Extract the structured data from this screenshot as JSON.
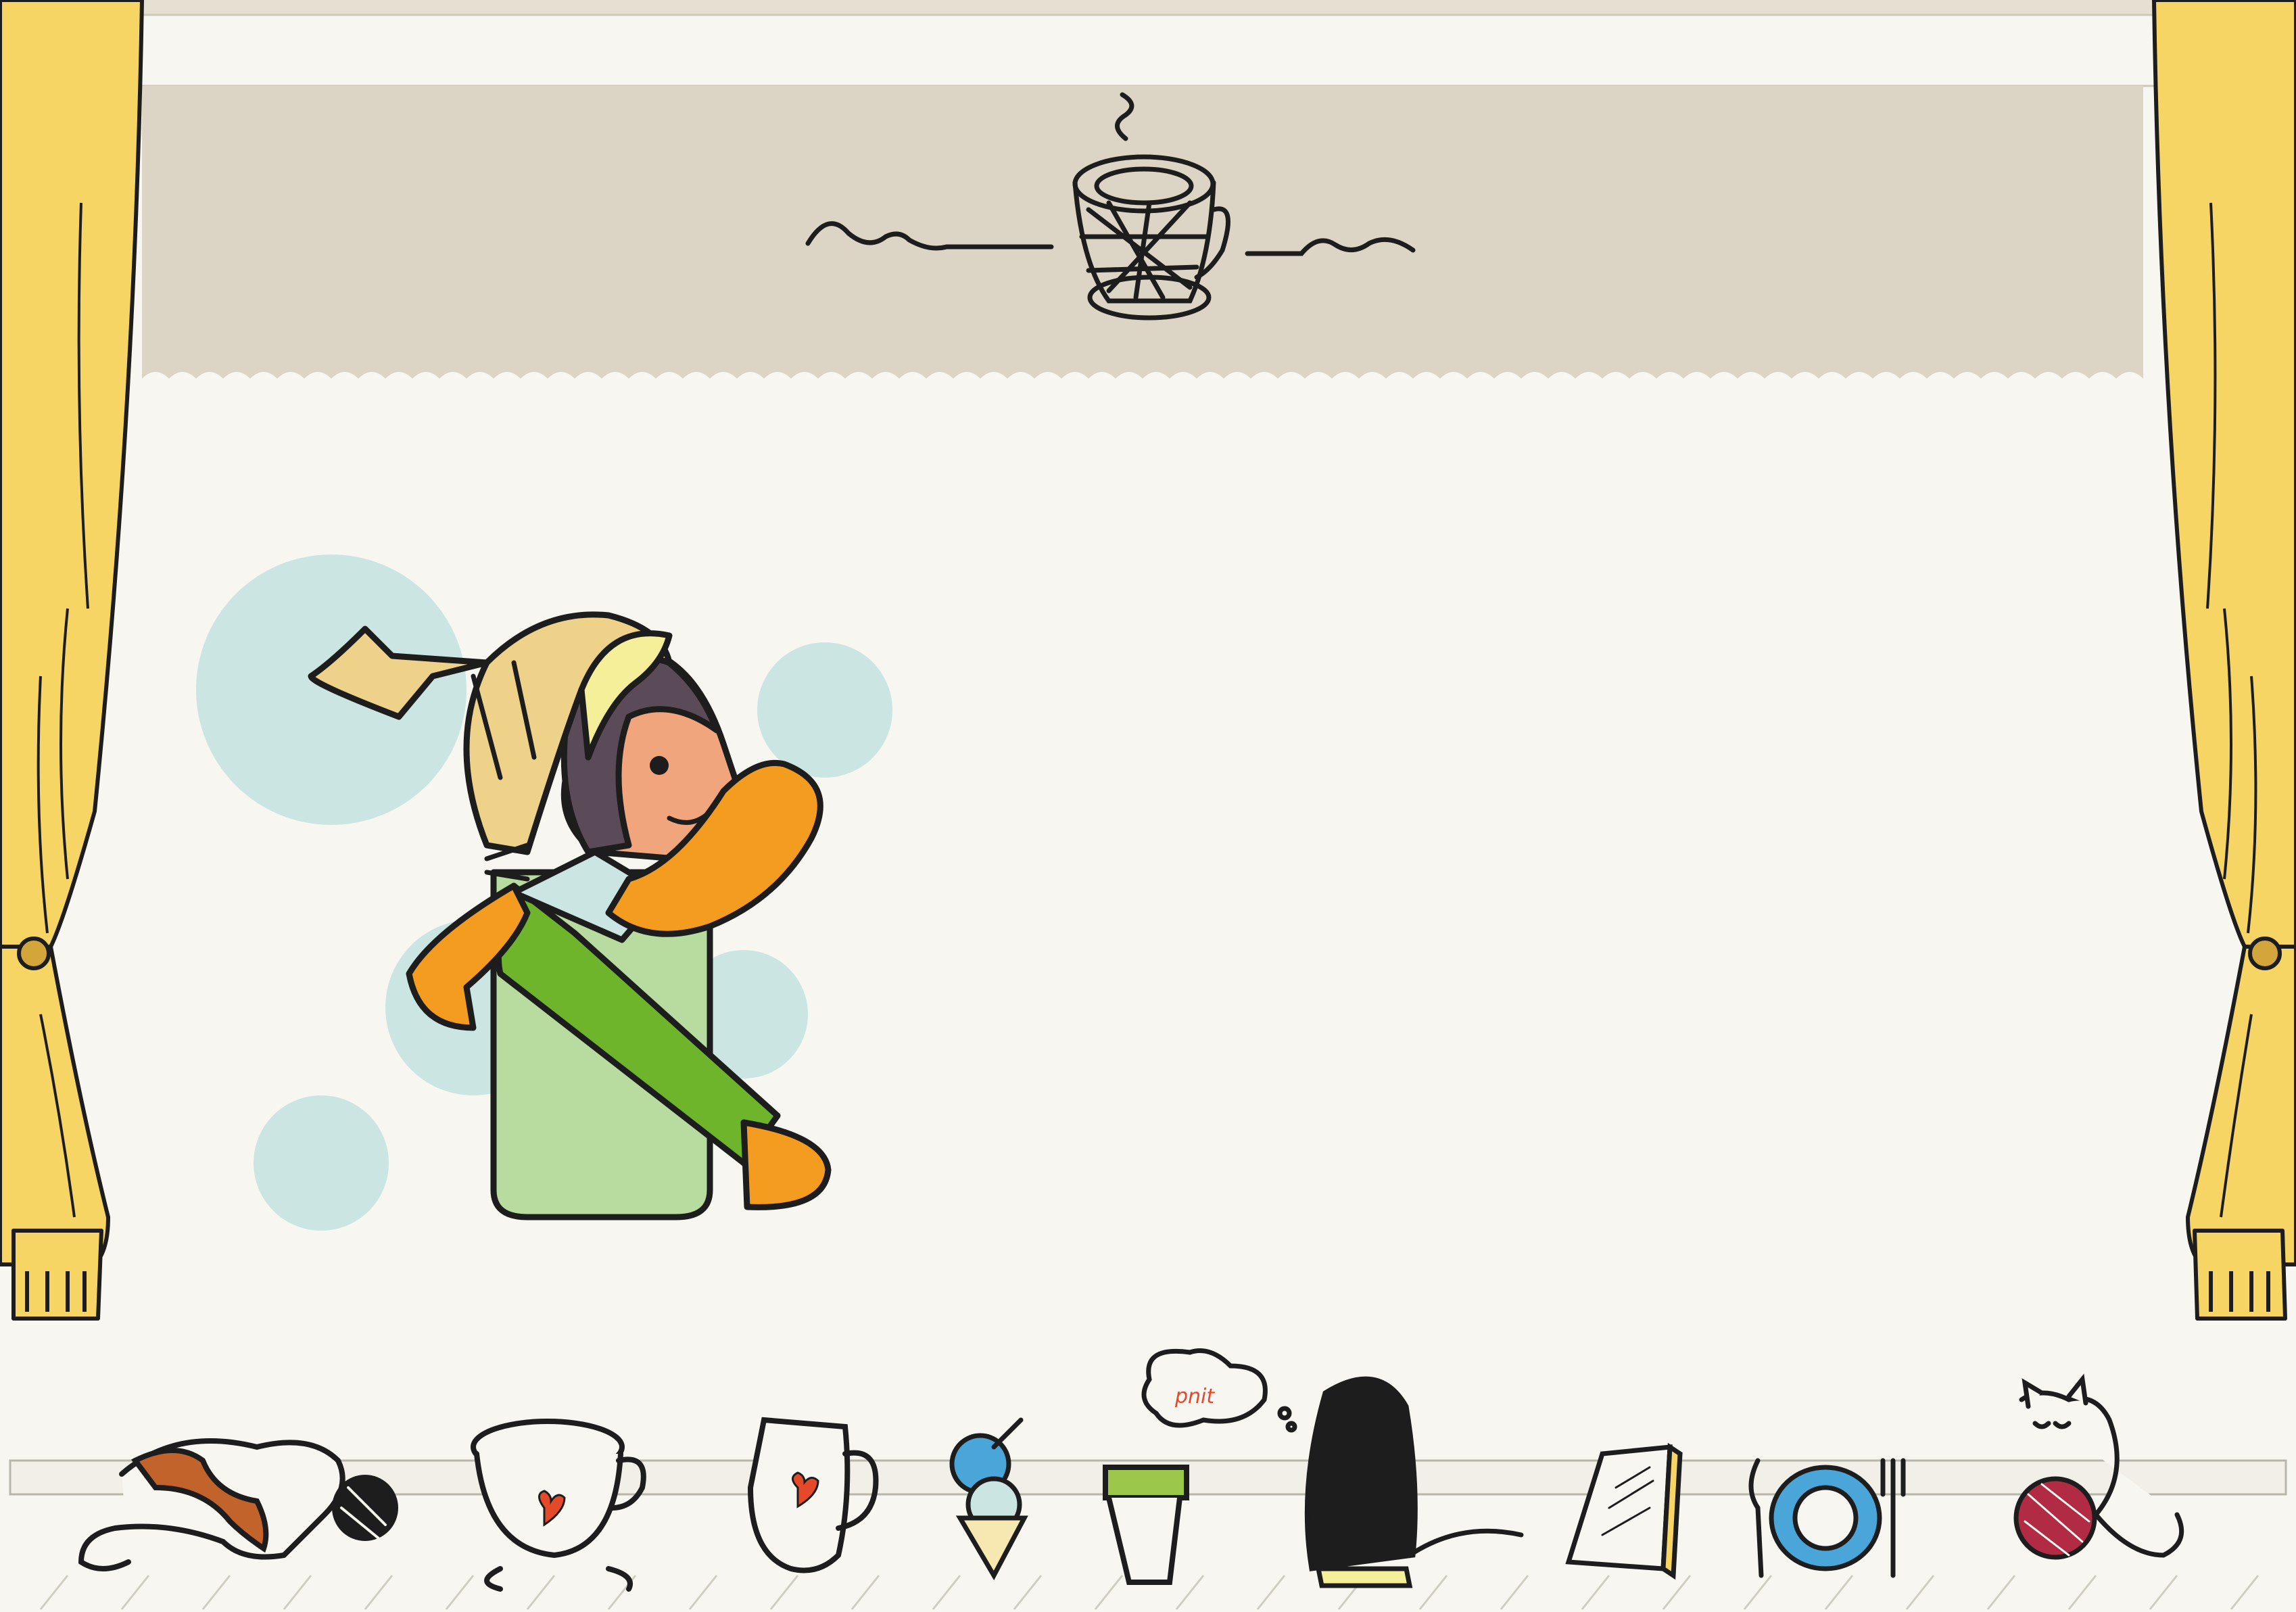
{
  "scene": {
    "header_icon": "coffee-cup-icon",
    "shelf_items": [
      {
        "icon": "cat-with-yarn-ball-icon"
      },
      {
        "icon": "teacup-heart-icon"
      },
      {
        "icon": "mug-heart-icon"
      },
      {
        "icon": "ice-cream-cone-icon"
      },
      {
        "icon": "takeaway-cup-icon"
      },
      {
        "icon": "girl-thinking-icon",
        "speech_bubble_text": "pnit"
      },
      {
        "icon": "notebook-icon"
      },
      {
        "icon": "plate-spoon-fork-icon"
      },
      {
        "icon": "cat-playing-yarn-icon"
      }
    ]
  },
  "colors": {
    "background": "#f7f6f0",
    "valance": "#dcd5c6",
    "curtain": "#f6d565",
    "bubbles": "#cbe5e2",
    "hat_yellow": "#f6ef9a",
    "hat_tan": "#efd28a",
    "skin": "#f0a57d",
    "hair": "#5b4a58",
    "orange": "#f39c1f",
    "coat": "#b8dba0",
    "stripe_green": "#6fb52c",
    "accent_red": "#e44a2a",
    "bowl_blue": "#4aa6d9"
  }
}
